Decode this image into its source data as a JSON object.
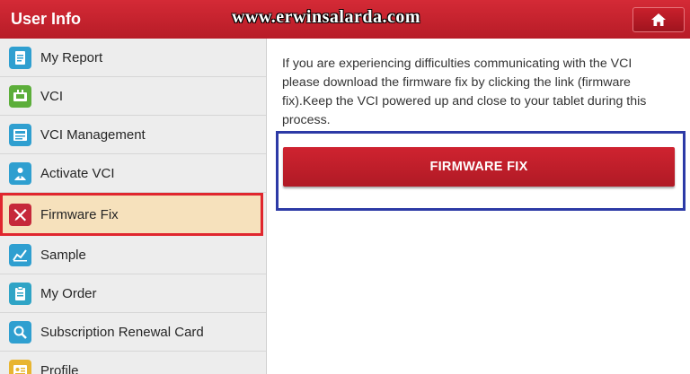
{
  "header": {
    "title": "User Info",
    "watermark": "www.erwinsalarda.com"
  },
  "sidebar": {
    "items": [
      {
        "label": "My Report",
        "icon": "report-icon"
      },
      {
        "label": "VCI",
        "icon": "vci-icon"
      },
      {
        "label": "VCI Management",
        "icon": "vci-management-icon"
      },
      {
        "label": "Activate VCI",
        "icon": "activate-vci-icon"
      },
      {
        "label": "Firmware Fix",
        "icon": "wrench-screwdriver-icon",
        "selected": true
      },
      {
        "label": "Sample",
        "icon": "sample-chart-icon"
      },
      {
        "label": "My Order",
        "icon": "order-icon"
      },
      {
        "label": "Subscription Renewal Card",
        "icon": "search-card-icon"
      },
      {
        "label": "Profile",
        "icon": "profile-icon"
      }
    ]
  },
  "main": {
    "message_part1": "If you are experiencing difficulties communicating with the VCI please download the firmware fix by clicking the link (firmware fix).",
    "message_part2": "Keep the VCI powered up and close to your tablet during this process.",
    "firmware_button_label": "FIRMWARE FIX"
  },
  "colors": {
    "header_red": "#c4222e",
    "selected_bg": "#f6e1bc",
    "highlight_red": "#e0262e",
    "highlight_blue": "#2d3aa6"
  }
}
